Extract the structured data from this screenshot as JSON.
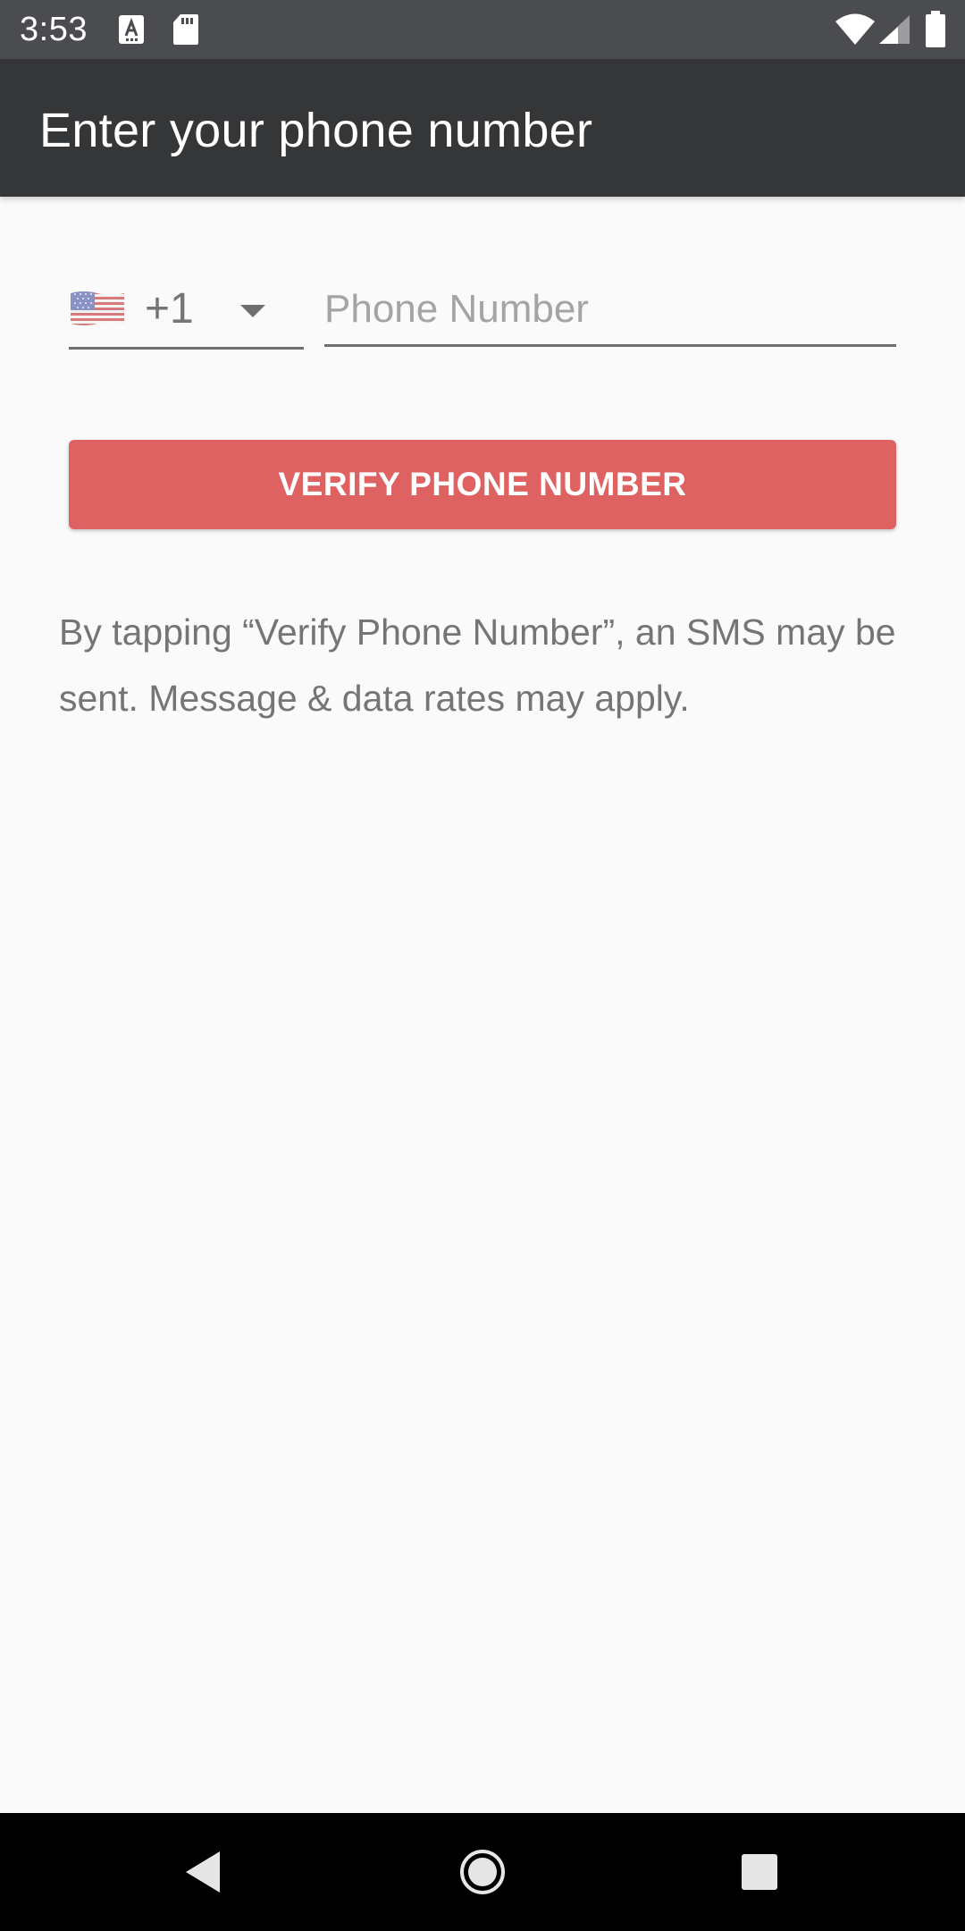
{
  "status_bar": {
    "time": "3:53",
    "icons": [
      "keyboard-a-icon",
      "sd-card-icon",
      "wifi-icon",
      "cell-signal-icon",
      "battery-icon"
    ]
  },
  "app_bar": {
    "title": "Enter your phone number",
    "background": "#353638"
  },
  "phone_form": {
    "country_flag": "us-flag-icon",
    "dial_code": "+1",
    "dropdown_icon": "chevron-down-icon",
    "phone_placeholder": "Phone Number",
    "phone_value": ""
  },
  "verify_button": {
    "label": "VERIFY PHONE NUMBER",
    "color": "#de6261"
  },
  "disclaimer": {
    "text": "By tapping “Verify Phone Number”, an SMS may be sent. Message & data rates may apply."
  },
  "nav_bar": {
    "icons": [
      "back-icon",
      "home-icon",
      "recents-icon"
    ]
  }
}
